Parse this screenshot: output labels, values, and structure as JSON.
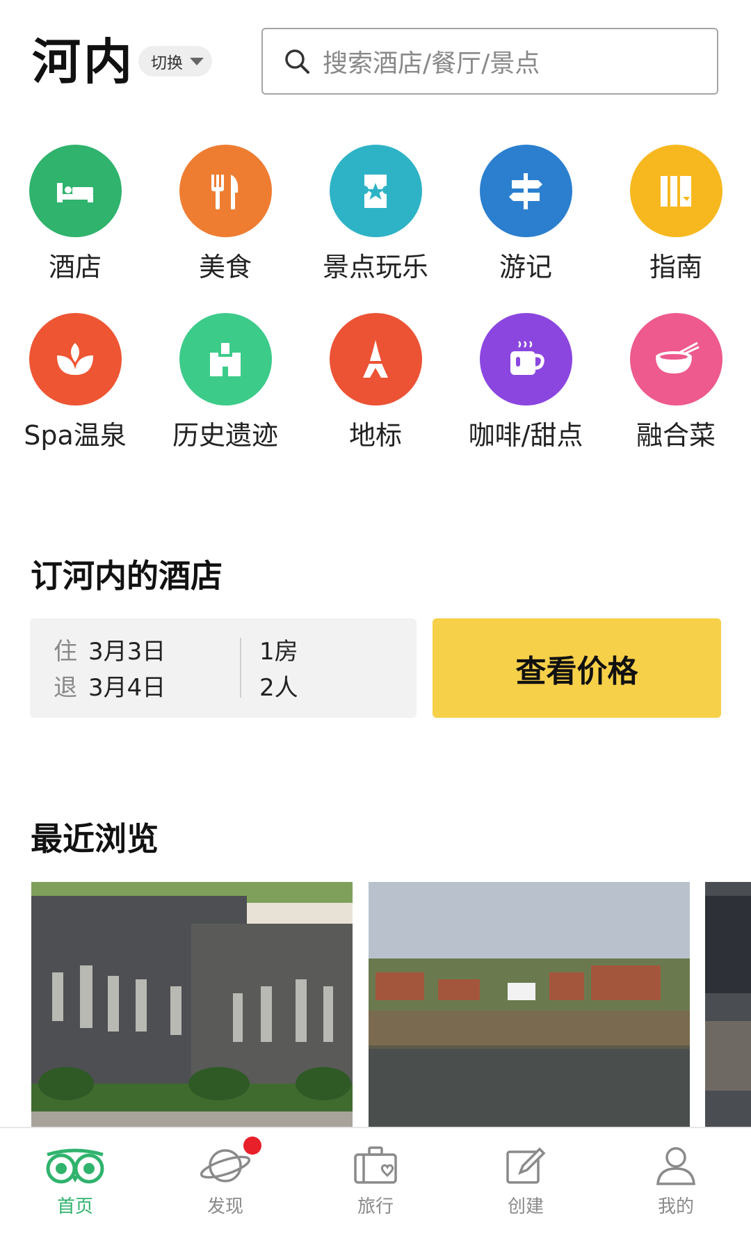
{
  "header": {
    "city": "河内",
    "switch_label": "切换",
    "search_placeholder": "搜索酒店/餐厅/景点"
  },
  "categories": [
    {
      "label": "酒店",
      "icon": "bed-icon",
      "color": "#2fb36d"
    },
    {
      "label": "美食",
      "icon": "fork-knife-icon",
      "color": "#ee7d32"
    },
    {
      "label": "景点玩乐",
      "icon": "ticket-star-icon",
      "color": "#2eb3c6"
    },
    {
      "label": "游记",
      "icon": "signpost-icon",
      "color": "#2b7fce"
    },
    {
      "label": "指南",
      "icon": "guide-book-icon",
      "color": "#f7b81f"
    },
    {
      "label": "Spa温泉",
      "icon": "lotus-icon",
      "color": "#ee5532"
    },
    {
      "label": "历史遗迹",
      "icon": "castle-icon",
      "color": "#3dcb8a"
    },
    {
      "label": "地标",
      "icon": "eiffel-tower-icon",
      "color": "#ec5234"
    },
    {
      "label": "咖啡/甜点",
      "icon": "coffee-cup-icon",
      "color": "#8b46e0"
    },
    {
      "label": "融合菜",
      "icon": "noodle-bowl-icon",
      "color": "#ee5a8e"
    }
  ],
  "booking": {
    "title": "订河内的酒店",
    "checkin_label": "住",
    "checkin_date": "3月3日",
    "checkout_label": "退",
    "checkout_date": "3月4日",
    "rooms": "1房",
    "guests": "2人",
    "cta": "查看价格"
  },
  "recent": {
    "title": "最近浏览"
  },
  "tabs": [
    {
      "label": "首页",
      "icon": "owl-eyes-icon",
      "active": true
    },
    {
      "label": "发现",
      "icon": "planet-icon",
      "active": false
    },
    {
      "label": "旅行",
      "icon": "suitcase-heart-icon",
      "active": false
    },
    {
      "label": "创建",
      "icon": "edit-icon",
      "active": false
    },
    {
      "label": "我的",
      "icon": "user-icon",
      "active": false
    }
  ],
  "colors": {
    "accent_green": "#2fb36d",
    "cta_yellow": "#f7d049",
    "notification_red": "#e8202a"
  }
}
